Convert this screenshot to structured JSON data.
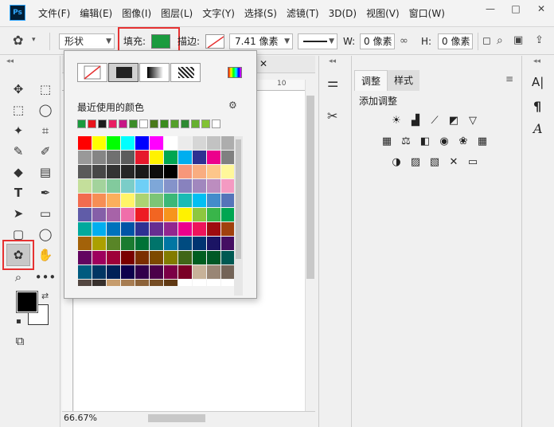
{
  "app": {
    "logo_text": "Ps"
  },
  "menu": [
    "文件(F)",
    "编辑(E)",
    "图像(I)",
    "图层(L)",
    "文字(Y)",
    "选择(S)",
    "滤镜(T)",
    "3D(D)",
    "视图(V)",
    "窗口(W)"
  ],
  "window_controls": {
    "minimize": "—",
    "maximize": "□",
    "close": "✕"
  },
  "options": {
    "mode_value": "形状",
    "fill_label": "填充:",
    "fill_color": "#1a9b3e",
    "stroke_label": "描边:",
    "stroke_width": "7.41 像素",
    "w_label": "W:",
    "w_value": "0 像素",
    "h_label": "H:",
    "h_value": "0 像素"
  },
  "document": {
    "tab_close": "✕",
    "ruler_mark": "10",
    "zoom": "66.67%"
  },
  "adjustments_panel": {
    "tabs": [
      "调整",
      "样式"
    ],
    "heading": "添加调整"
  },
  "right_strip_icons": [
    "A|",
    "¶",
    "A"
  ],
  "fill_popup": {
    "recent_label": "最近使用的颜色",
    "recent_colors": [
      "#1a9b3e",
      "#e8141c",
      "#1c1c1c",
      "#e91e63",
      "#c71585",
      "#3c8c28",
      "#ffffff",
      "#4a7a1a",
      "#3b8c1e",
      "#54a02a",
      "#2e8a32",
      "#66b030",
      "#82c234",
      "#ffffff"
    ],
    "swatch_rows": [
      [
        "#ff0000",
        "#ffff00",
        "#00ff00",
        "#00ffff",
        "#0000ff",
        "#ff00ff",
        "#ffffff",
        "#ebebeb",
        "#d6d6d6",
        "#c2c2c2",
        "#adadad"
      ],
      [
        "#999999",
        "#858585",
        "#707070",
        "#5c5c5c",
        "#e6192c",
        "#fff200",
        "#00a651",
        "#00aeef",
        "#2e3192",
        "#ec008c",
        "#808080"
      ],
      [
        "#5a5a5a",
        "#474747",
        "#333333",
        "#262626",
        "#1a1a1a",
        "#0d0d0d",
        "#000000",
        "#f7977a",
        "#f9ad81",
        "#fdc68a",
        "#fff79a"
      ],
      [
        "#c4df9b",
        "#a3d39c",
        "#82ca9d",
        "#7bcdc8",
        "#6ecff6",
        "#7ea7d8",
        "#8493ca",
        "#8882be",
        "#a187be",
        "#bc8dbf",
        "#f49ac2"
      ],
      [
        "#f26c4f",
        "#f68e55",
        "#fbaf5c",
        "#fff467",
        "#acd372",
        "#7cc576",
        "#3bb878",
        "#1abbb4",
        "#00bff3",
        "#438ccb",
        "#5574b9"
      ],
      [
        "#605ca8",
        "#855fa8",
        "#a763a8",
        "#f06eaa",
        "#ed1c24",
        "#f26522",
        "#f7941d",
        "#fff200",
        "#8dc73f",
        "#39b54a",
        "#00a651"
      ],
      [
        "#00a99d",
        "#00aeef",
        "#0072bc",
        "#0054a6",
        "#2e3192",
        "#662d91",
        "#92278f",
        "#ec008c",
        "#ed145b",
        "#9e0b0f",
        "#a0410d"
      ],
      [
        "#a36209",
        "#aba000",
        "#598527",
        "#1a7b30",
        "#007236",
        "#00746b",
        "#0076a3",
        "#004b80",
        "#003471",
        "#1b1464",
        "#440e62"
      ],
      [
        "#630460",
        "#9e005d",
        "#9e0039",
        "#790000",
        "#7b2e00",
        "#7d4900",
        "#827b00",
        "#406618",
        "#005e20",
        "#005826",
        "#005952"
      ],
      [
        "#005b7f",
        "#003663",
        "#002157",
        "#0d004c",
        "#32004b",
        "#4b0049",
        "#7b0046",
        "#7a0026",
        "#c7b299",
        "#998675",
        "#736357"
      ],
      [
        "#534741",
        "#37302d",
        "#c69c6d",
        "#a67c52",
        "#8c6239",
        "#754c24",
        "#603913",
        "#ffffff",
        "#ffffff",
        "#ffffff",
        "#ffffff"
      ]
    ]
  }
}
